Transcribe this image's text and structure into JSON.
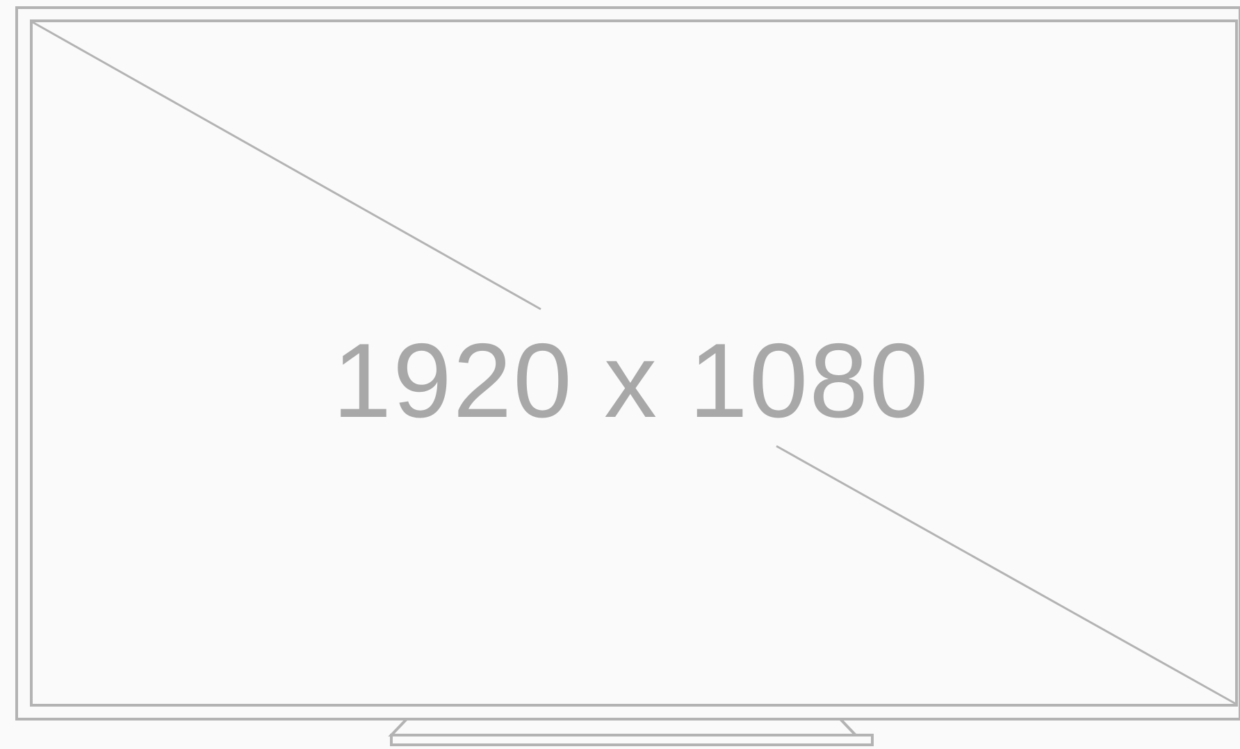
{
  "placeholder": {
    "resolution_text": "1920 x 1080"
  },
  "colors": {
    "background": "#fafafa",
    "stroke": "#b3b3b3",
    "text": "#a8a8a8"
  }
}
